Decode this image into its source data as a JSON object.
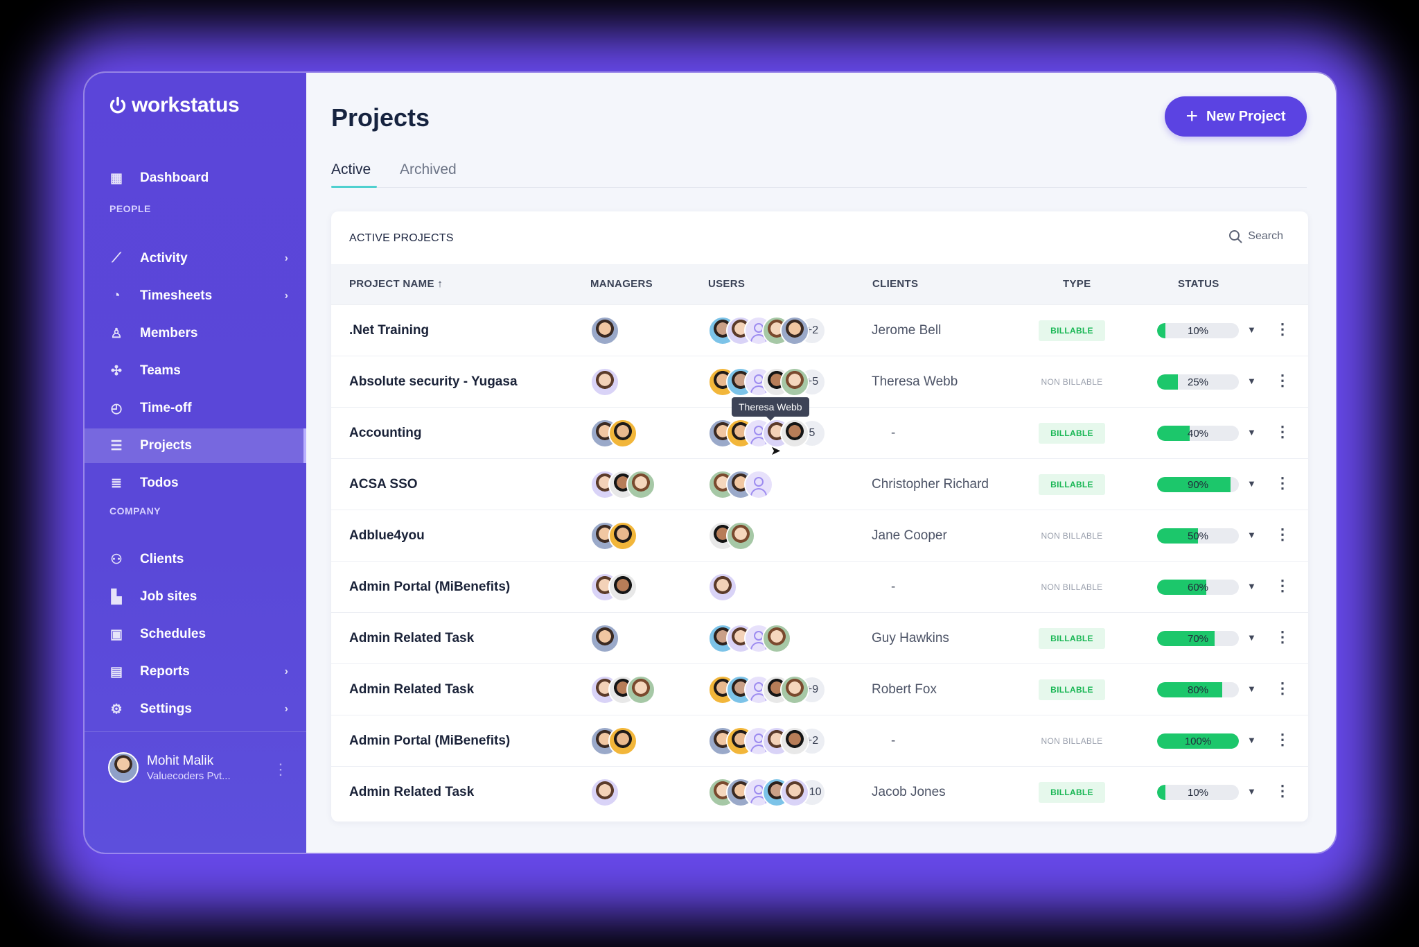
{
  "brand": {
    "name": "workstatus"
  },
  "sidebar": {
    "items": [
      {
        "label": "Dashboard",
        "icon": "dashboard-icon"
      },
      {
        "label": "Activity",
        "icon": "chart-line-icon",
        "chevron": true
      },
      {
        "label": "Timesheets",
        "icon": "pie-chart-icon",
        "chevron": true
      },
      {
        "label": "Members",
        "icon": "user-icon"
      },
      {
        "label": "Teams",
        "icon": "teams-icon"
      },
      {
        "label": "Time-off",
        "icon": "clock-icon"
      },
      {
        "label": "Projects",
        "icon": "projects-icon",
        "active": true
      },
      {
        "label": "Todos",
        "icon": "todo-icon"
      },
      {
        "label": "Clients",
        "icon": "clients-icon"
      },
      {
        "label": "Job sites",
        "icon": "building-icon"
      },
      {
        "label": "Schedules",
        "icon": "calendar-icon"
      },
      {
        "label": "Reports",
        "icon": "report-icon",
        "chevron": true
      },
      {
        "label": "Settings",
        "icon": "gear-icon",
        "chevron": true
      }
    ],
    "sections": {
      "people": "PEOPLE",
      "company": "COMPANY"
    },
    "user": {
      "name": "Mohit Malik",
      "org": "Valuecoders Pvt..."
    }
  },
  "header": {
    "title": "Projects",
    "new_button": "New Project"
  },
  "tabs": [
    {
      "label": "Active",
      "active": true
    },
    {
      "label": "Archived"
    }
  ],
  "table": {
    "title": "ACTIVE PROJECTS",
    "search_label": "Search",
    "columns": {
      "name": "PROJECT NAME ↑",
      "managers": "MANAGERS",
      "users": "USERS",
      "clients": "CLIENTS",
      "type": "TYPE",
      "status": "STATUS"
    },
    "tooltip": "Theresa Webb",
    "rows": [
      {
        "name": ".Net Training",
        "managers": 1,
        "users": 5,
        "more": "+2",
        "client": "Jerome Bell",
        "type": "BILLABLE",
        "billable": true,
        "status": "10%",
        "progress": 10
      },
      {
        "name": "Absolute security - Yugasa",
        "managers": 1,
        "users": 5,
        "more": "+5",
        "client": "Theresa Webb",
        "type": "NON BILLABLE",
        "billable": false,
        "status": "25%",
        "progress": 25
      },
      {
        "name": "Accounting",
        "managers": 2,
        "users": 5,
        "more": "5",
        "client": "-",
        "type": "BILLABLE",
        "billable": true,
        "status": "40%",
        "progress": 40
      },
      {
        "name": "ACSA SSO",
        "managers": 3,
        "users": 3,
        "more": "",
        "client": "Christopher Richard",
        "type": "BILLABLE",
        "billable": true,
        "status": "90%",
        "progress": 90
      },
      {
        "name": "Adblue4you",
        "managers": 2,
        "users": 2,
        "more": "",
        "client": "Jane Cooper",
        "type": "NON BILLABLE",
        "billable": false,
        "status": "50%",
        "progress": 50
      },
      {
        "name": "Admin Portal (MiBenefits)",
        "managers": 2,
        "users": 1,
        "more": "",
        "client": "-",
        "type": "NON BILLABLE",
        "billable": false,
        "status": "60%",
        "progress": 60
      },
      {
        "name": "Admin Related Task",
        "managers": 1,
        "users": 4,
        "more": "",
        "client": "Guy Hawkins",
        "type": "BILLABLE",
        "billable": true,
        "status": "70%",
        "progress": 70
      },
      {
        "name": "Admin Related Task",
        "managers": 3,
        "users": 5,
        "more": "+9",
        "client": "Robert Fox",
        "type": "BILLABLE",
        "billable": true,
        "status": "80%",
        "progress": 80
      },
      {
        "name": "Admin Portal (MiBenefits)",
        "managers": 2,
        "users": 5,
        "more": "+2",
        "client": "-",
        "type": "NON BILLABLE",
        "billable": false,
        "status": "100%",
        "progress": 100
      },
      {
        "name": "Admin Related Task",
        "managers": 1,
        "users": 5,
        "more": "+10",
        "client": "Jacob Jones",
        "type": "BILLABLE",
        "billable": true,
        "status": "10%",
        "progress": 10
      }
    ]
  },
  "colors": {
    "accent": "#5b43e2",
    "progress": "#1cc76b",
    "billable": "#17b653",
    "tab_underline": "#4fd0cf"
  }
}
